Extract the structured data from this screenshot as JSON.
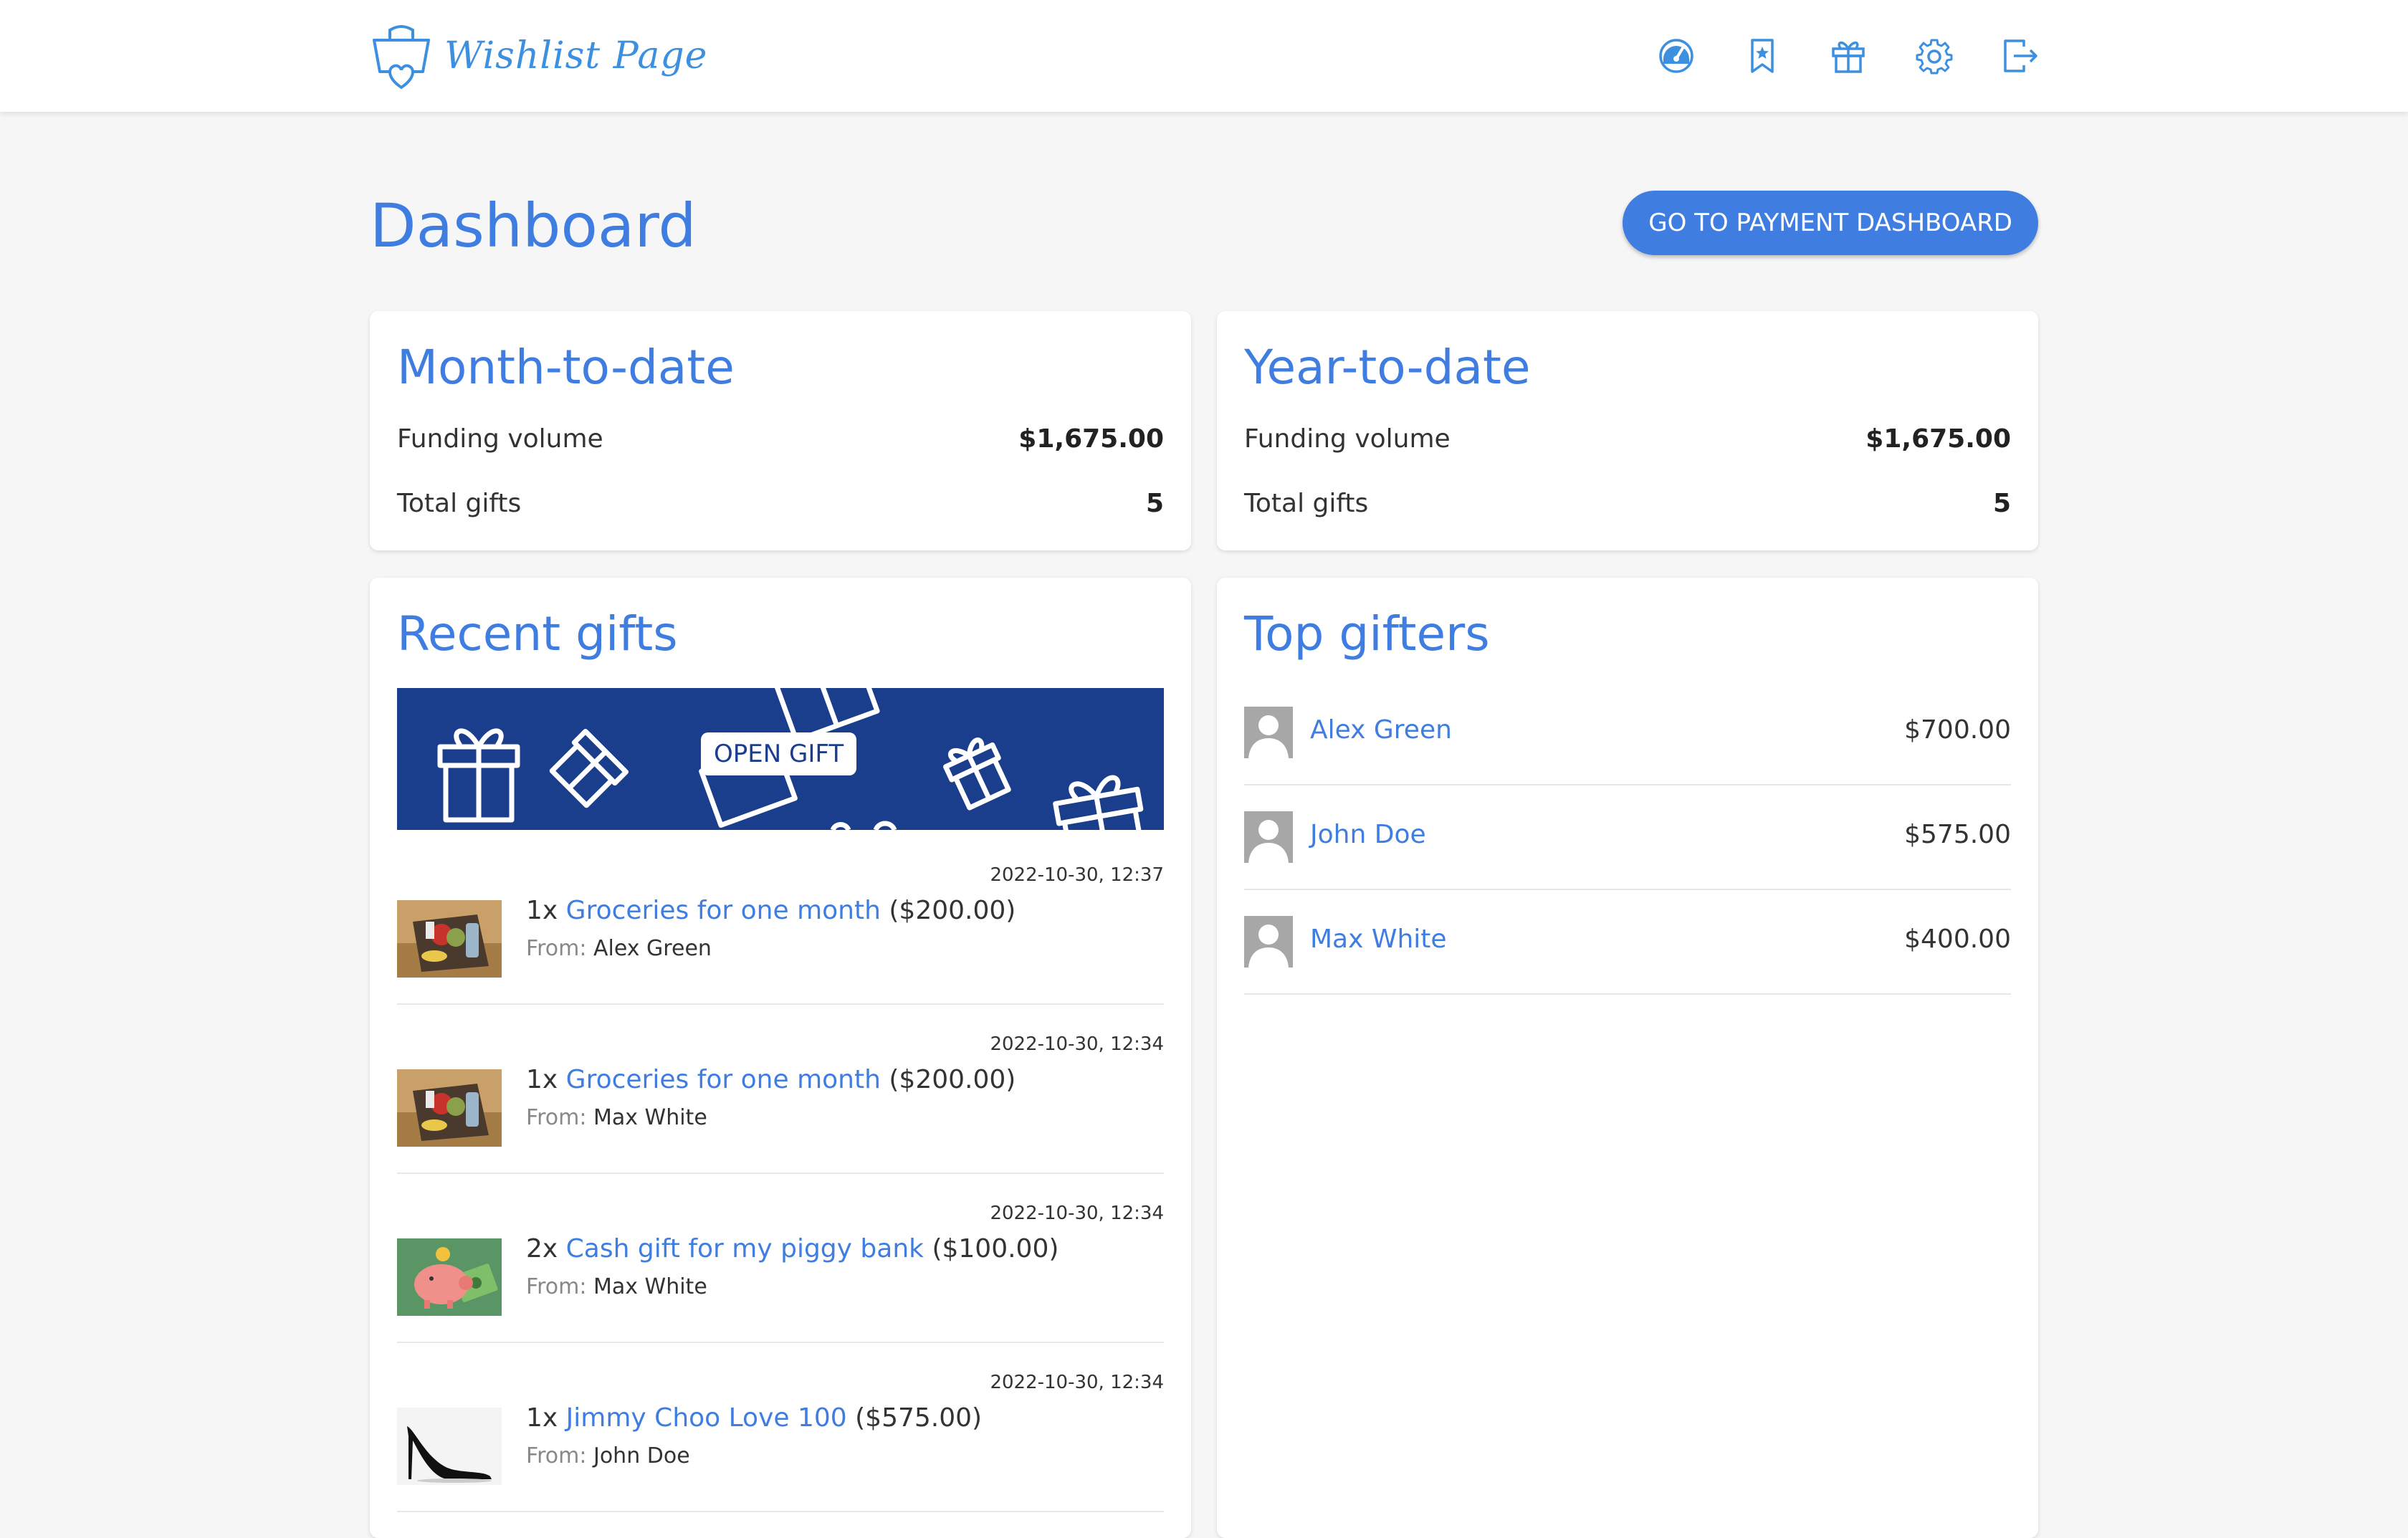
{
  "header": {
    "logo_text": "Wishlist Page",
    "nav_icons": [
      "dashboard-icon",
      "bookmark-icon",
      "gift-icon",
      "gear-icon",
      "logout-icon"
    ]
  },
  "page": {
    "title": "Dashboard",
    "payment_button": "GO TO PAYMENT DASHBOARD"
  },
  "month_to_date": {
    "title": "Month-to-date",
    "funding_label": "Funding volume",
    "funding_value": "$1,675.00",
    "gifts_label": "Total gifts",
    "gifts_value": "5"
  },
  "year_to_date": {
    "title": "Year-to-date",
    "funding_label": "Funding volume",
    "funding_value": "$1,675.00",
    "gifts_label": "Total gifts",
    "gifts_value": "5"
  },
  "recent_gifts": {
    "title": "Recent gifts",
    "banner_label": "OPEN GIFT",
    "from_label": "From:",
    "items": [
      {
        "timestamp": "2022-10-30, 12:37",
        "qty": "1x",
        "name": "Groceries for one month",
        "price": "($200.00)",
        "from": "Alex Green",
        "thumb": "groceries"
      },
      {
        "timestamp": "2022-10-30, 12:34",
        "qty": "1x",
        "name": "Groceries for one month",
        "price": "($200.00)",
        "from": "Max White",
        "thumb": "groceries"
      },
      {
        "timestamp": "2022-10-30, 12:34",
        "qty": "2x",
        "name": "Cash gift for my piggy bank",
        "price": "($100.00)",
        "from": "Max White",
        "thumb": "piggy-bank"
      },
      {
        "timestamp": "2022-10-30, 12:34",
        "qty": "1x",
        "name": "Jimmy Choo Love 100",
        "price": "($575.00)",
        "from": "John Doe",
        "thumb": "high-heel"
      }
    ]
  },
  "top_gifters": {
    "title": "Top gifters",
    "items": [
      {
        "name": "Alex Green",
        "amount": "$700.00"
      },
      {
        "name": "John Doe",
        "amount": "$575.00"
      },
      {
        "name": "Max White",
        "amount": "$400.00"
      }
    ]
  },
  "colors": {
    "accent": "#3f7de0",
    "banner": "#1a3e8c",
    "background": "#f6f6f6"
  }
}
